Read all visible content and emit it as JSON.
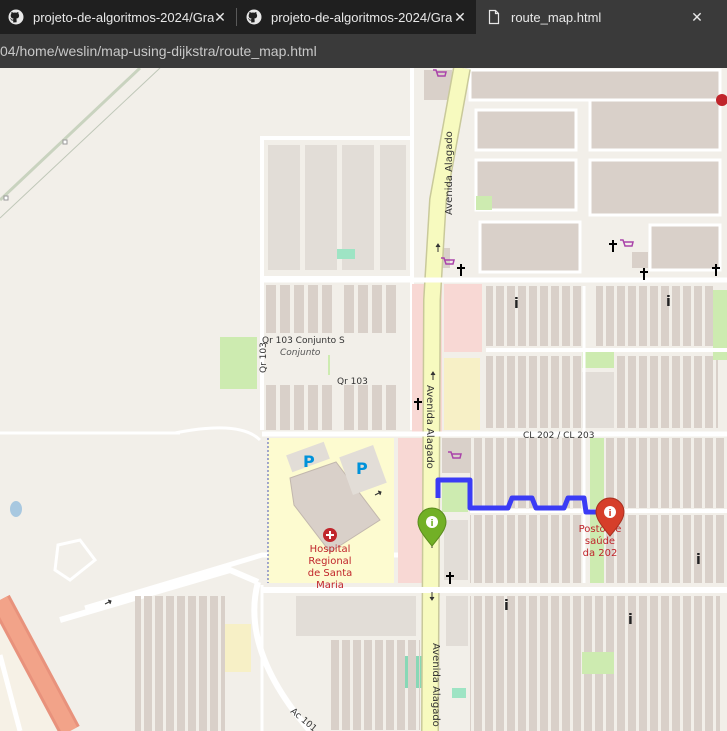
{
  "tabs": [
    {
      "title": "projeto-de-algoritmos-2024/Gra",
      "icon": "github-icon",
      "active": false
    },
    {
      "title": "projeto-de-algoritmos-2024/Gra",
      "icon": "github-icon",
      "active": false
    },
    {
      "title": "route_map.html",
      "icon": "document-icon",
      "active": true
    }
  ],
  "tab_close_glyph": "✕",
  "address": {
    "url": "04/home/weslin/map-using-dijkstra/route_map.html"
  },
  "map": {
    "labels": {
      "avenida_north": "Avenida Alagado",
      "avenida_mid": "Avenida Alagado",
      "avenida_south": "Avenida Alagado",
      "qr103_conjunto": "Qr 103 Conjunto S",
      "conjunto": "Conjunto",
      "qr103_vertical": "Qr 103",
      "qr103": "Qr 103",
      "cl202": "CL 202 / CL 203",
      "hospital_line1": "Hospital",
      "hospital_line2": "Regional",
      "hospital_line3": "de Santa",
      "hospital_line4": "Maria",
      "posto_line1": "Posto de",
      "posto_line2": "saúde",
      "posto_line3": "da 202",
      "ac101": "Ac 101",
      "parking": "P"
    },
    "colors": {
      "route": "#3b3bf5",
      "start_marker": "#72b026",
      "end_marker": "#d63e2a",
      "avenue": "#f7fabf",
      "hospital_text": "#c0252b"
    },
    "markers": [
      {
        "name": "start-marker",
        "icon": "info-icon"
      },
      {
        "name": "end-marker",
        "icon": "info-icon"
      }
    ]
  }
}
